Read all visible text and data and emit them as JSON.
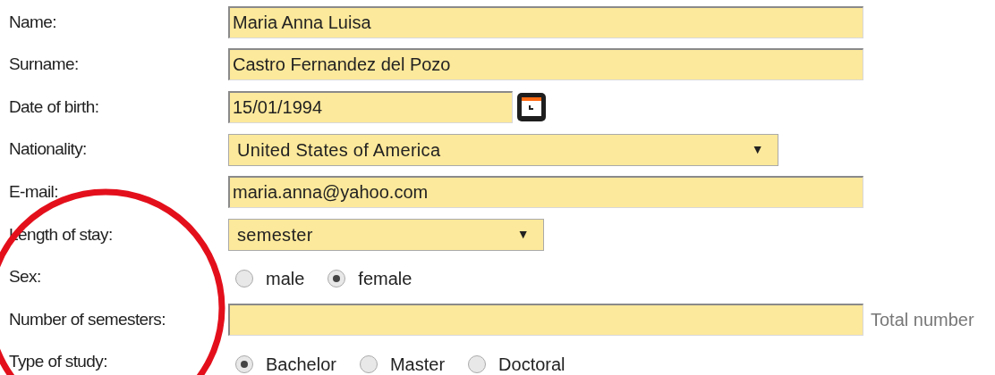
{
  "rows": [
    {
      "label": "Name:",
      "kind": "text",
      "value": "Maria Anna Luisa"
    },
    {
      "label": "Surname:",
      "kind": "text",
      "value": "Castro Fernandez del Pozo"
    },
    {
      "label": "Date of birth:",
      "kind": "date",
      "value": "15/01/1994"
    },
    {
      "label": "Nationality:",
      "kind": "select",
      "value": "United States of America",
      "arrow": "▼"
    },
    {
      "label": "E-mail:",
      "kind": "text",
      "value": "maria.anna@yahoo.com"
    },
    {
      "label": "Length of stay:",
      "kind": "select",
      "value": "semester",
      "arrow": "▼"
    },
    {
      "label": "Sex:",
      "kind": "radio",
      "options": [
        {
          "label": "male",
          "selected": false
        },
        {
          "label": "female",
          "selected": true
        }
      ]
    },
    {
      "label": "Number of semesters:",
      "kind": "text",
      "note": "Total number"
    },
    {
      "label": "Type of study:",
      "kind": "radio",
      "options": [
        {
          "label": "Bachelor",
          "selected": true
        },
        {
          "label": "Master",
          "selected": false
        },
        {
          "label": "Doctoral",
          "selected": false
        }
      ]
    }
  ]
}
